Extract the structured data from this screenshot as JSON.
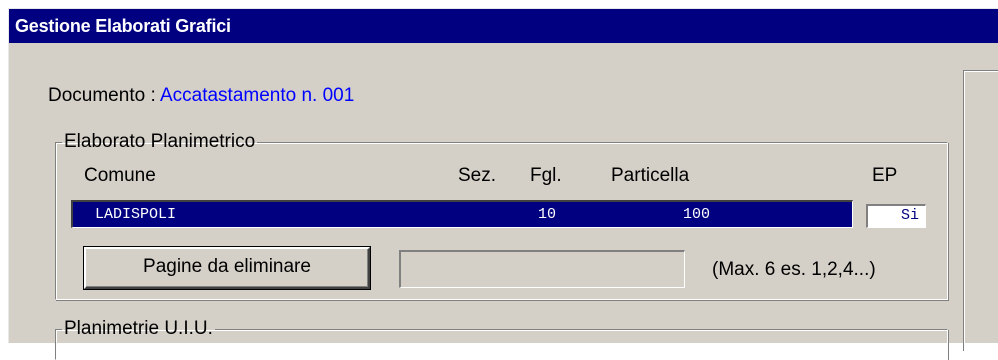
{
  "window": {
    "title": "Gestione Elaborati Grafici"
  },
  "documento": {
    "label": "Documento : ",
    "value": "Accatastamento n. 001"
  },
  "elaborato": {
    "legend": "Elaborato Planimetrico",
    "columns": {
      "comune": "Comune",
      "sez": "Sez.",
      "fgl": "Fgl.",
      "particella": "Particella",
      "ep": "EP"
    },
    "row": {
      "comune": "LADISPOLI",
      "sez": "",
      "fgl": "10",
      "particella": "100",
      "ep": "Si"
    },
    "button_label": "Pagine da eliminare",
    "pages_value": "",
    "hint": "(Max. 6  es. 1,2,4...)"
  },
  "planimetrie": {
    "legend": "Planimetrie U.I.U."
  },
  "colors": {
    "titlebar": "#000080",
    "selection": "#000080",
    "link_text": "#0000ff",
    "face": "#d4d0c8"
  }
}
